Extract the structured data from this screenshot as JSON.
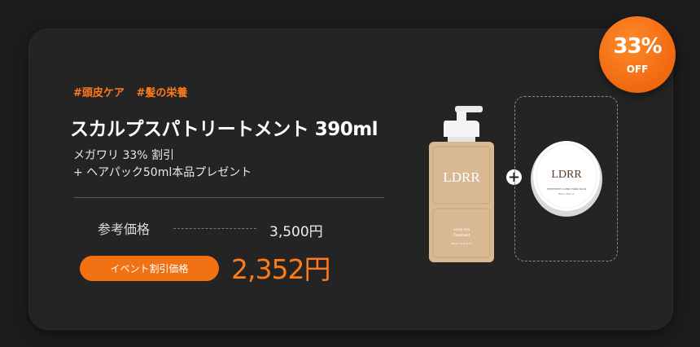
{
  "tags": [
    "#頭皮ケア",
    "#髪の栄養"
  ],
  "product_title": "スカルプスパトリートメント 390ml",
  "description": [
    "メガワリ 33% 割引",
    "+ ヘアパック50ml本品プレゼント"
  ],
  "reference": {
    "label": "参考価格",
    "price": "3,500円"
  },
  "event": {
    "label": "イベント割引価格",
    "price": "2,352円"
  },
  "badge": {
    "percent": "33%",
    "off": "OFF"
  },
  "bottle": {
    "brand": "LDRR",
    "line1": "Scalp Spa",
    "line2": "Treatment",
    "line3": "390ml / 13.18 fl. oz."
  },
  "jar": {
    "brand": "LDRR",
    "line1": "INTENSIVE CLINIC HAIR PACK",
    "line2": "50ml / 1.69 fl. oz."
  },
  "colors": {
    "accent": "#f27113",
    "card": "#242424",
    "background": "#1c1c1c",
    "bottle": "#d8b994"
  }
}
